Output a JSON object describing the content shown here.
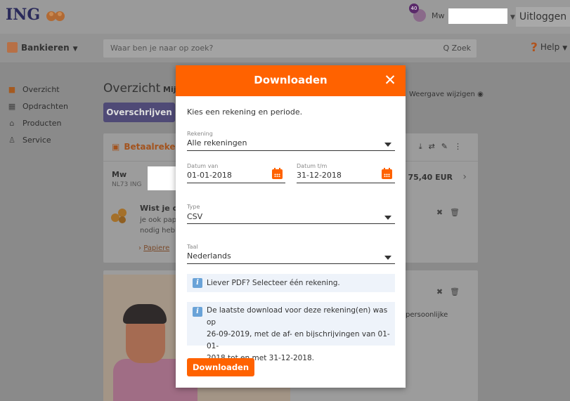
{
  "header": {
    "logo_text": "ING",
    "badge_count": "40",
    "user_prefix": "Mw",
    "logout_label": "Uitloggen"
  },
  "navbar": {
    "bank_label": "Bankieren",
    "search_placeholder": "Waar ben je naar op zoek?",
    "search_button": "Q Zoek",
    "help_label": "Help"
  },
  "sidenav": {
    "items": [
      {
        "label": "Overzicht",
        "icon": "home-icon"
      },
      {
        "label": "Opdrachten",
        "icon": "calendar-icon"
      },
      {
        "label": "Producten",
        "icon": "bank-icon"
      },
      {
        "label": "Service",
        "icon": "person-icon"
      }
    ]
  },
  "content": {
    "title": "Overzicht",
    "tab_partial": "Mij",
    "overschrijven_label": "Overschrijven",
    "weergave_label": "Weergave wijzigen"
  },
  "account_card": {
    "title_partial": "Betaalreke",
    "holder_prefix": "Mw",
    "iban_partial": "NL73 ING",
    "balance": "75,40 EUR",
    "tip_title": "Wist je dat",
    "tip_body": "je ook papi nodig hebb",
    "tip_link": "Papiere"
  },
  "promo_card": {
    "text_partial": "persoonlijke"
  },
  "modal": {
    "title": "Downloaden",
    "intro": "Kies een rekening en periode.",
    "rekening": {
      "label": "Rekening",
      "value": "Alle rekeningen"
    },
    "datum_van": {
      "label": "Datum van",
      "value": "01-01-2018"
    },
    "datum_tm": {
      "label": "Datum t/m",
      "value": "31-12-2018"
    },
    "type": {
      "label": "Type",
      "value": "CSV"
    },
    "taal": {
      "label": "Taal",
      "value": "Nederlands"
    },
    "info_pdf": "Liever PDF? Selecteer één rekening.",
    "info_last_download_lines": [
      "De laatste download voor deze rekening(en) was op",
      "26-09-2019, met de af- en bijschrijvingen van 01-01-",
      "2018 tot en met 31-12-2018."
    ],
    "download_button": "Downloaden"
  },
  "colors": {
    "ing_orange": "#ff6200",
    "info_blue": "#6aa3d8"
  }
}
